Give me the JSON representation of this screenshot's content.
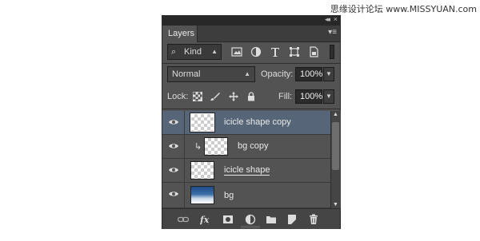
{
  "watermark": "思缘设计论坛 www.MISSYUAN.com",
  "panel": {
    "title": "Layers",
    "collapse_glyph": "◂◂",
    "close_glyph": "×",
    "menu_glyph": "▾≡"
  },
  "filter": {
    "kind_label": "Kind",
    "icons": [
      "image-filter-icon",
      "adjustment-filter-icon",
      "type-filter-icon",
      "shape-filter-icon",
      "smart-object-filter-icon"
    ]
  },
  "blend": {
    "mode": "Normal",
    "opacity_label": "Opacity:",
    "opacity_value": "100%"
  },
  "lock": {
    "label": "Lock:",
    "fill_label": "Fill:",
    "fill_value": "100%"
  },
  "layers": [
    {
      "name": "icicle shape copy",
      "selected": true,
      "clipped": false,
      "thumb": "transparent"
    },
    {
      "name": "bg copy",
      "selected": false,
      "clipped": true,
      "thumb": "transparent"
    },
    {
      "name": "icicle shape",
      "selected": false,
      "clipped": false,
      "thumb": "transparent"
    },
    {
      "name": "bg",
      "selected": false,
      "clipped": false,
      "thumb": "image"
    }
  ],
  "bottom_icons": [
    "link-layers-icon",
    "fx-icon",
    "mask-icon",
    "adjustment-layer-icon",
    "group-folder-icon",
    "new-layer-icon",
    "trash-icon"
  ],
  "colors": {
    "panel_bg": "#535353",
    "selected_row": "#566577",
    "dark_bar": "#282828"
  }
}
